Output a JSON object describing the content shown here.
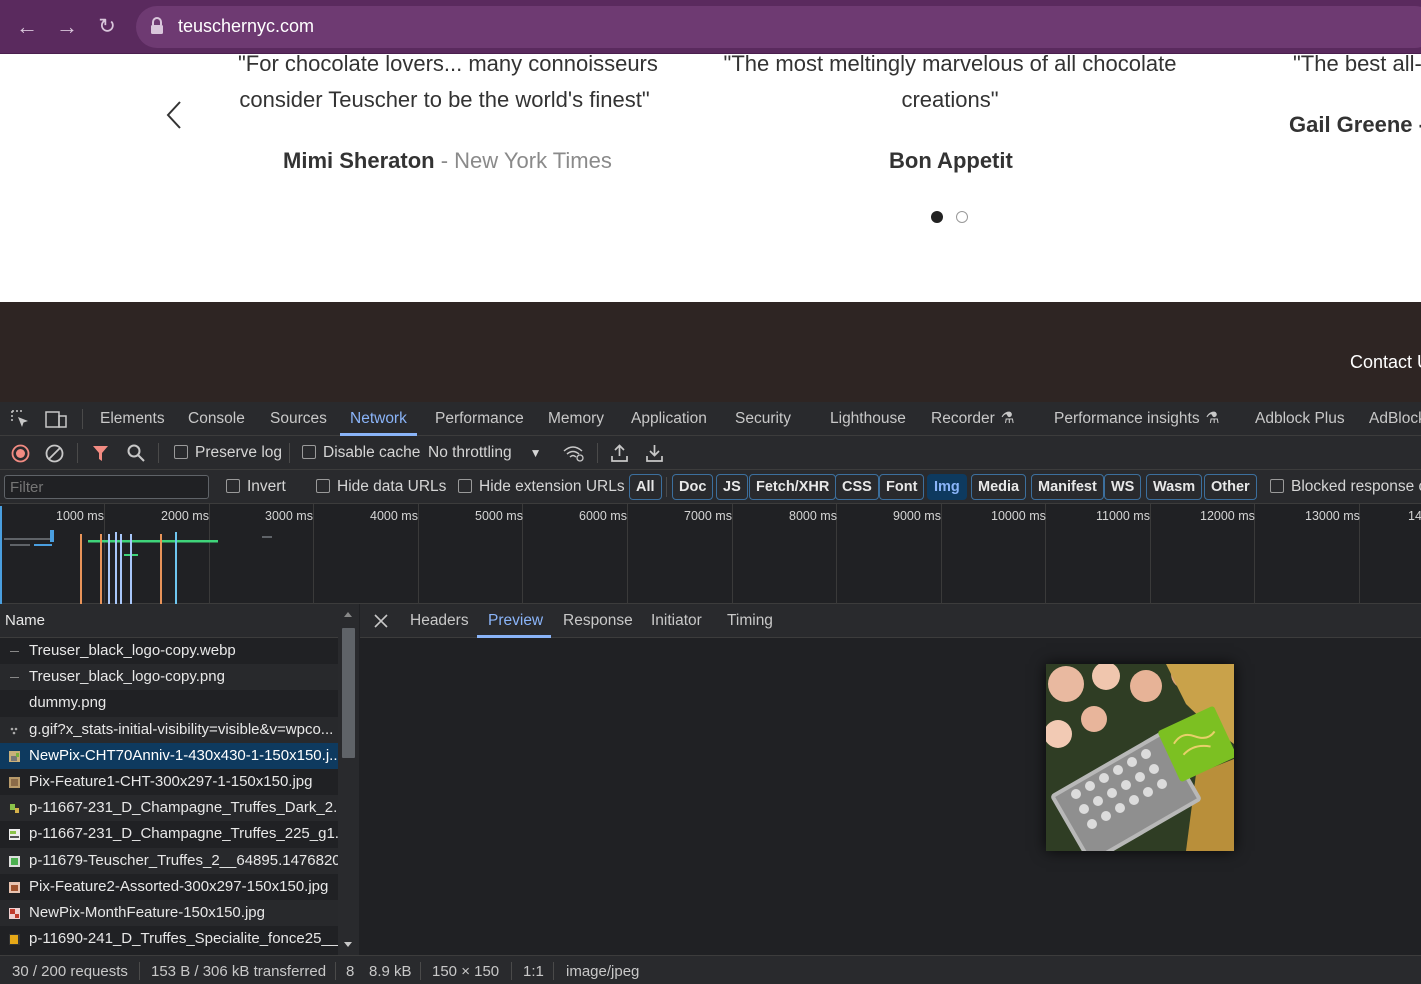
{
  "browser": {
    "url": "teuschernyc.com"
  },
  "testimonials": {
    "items": [
      {
        "quote_line1": "\"For chocolate lovers... many connoisseurs",
        "quote_line2": "consider Teuscher to be the world's finest\"",
        "author": "Mimi Sheraton",
        "source": " - New York Times"
      },
      {
        "quote_line1": "\"The most meltingly marvelous of all chocolate",
        "quote_line2": "creations\"",
        "author": "Bon Appetit",
        "source": ""
      },
      {
        "quote_line1": "\"The best all-",
        "quote_line2": "",
        "author": "Gail Greene -",
        "source": ""
      }
    ],
    "dots": 2,
    "active_dot": 0
  },
  "footer": {
    "contact_label": "Contact U"
  },
  "devtools": {
    "tabs": [
      "Elements",
      "Console",
      "Sources",
      "Network",
      "Performance",
      "Memory",
      "Application",
      "Security",
      "Lighthouse",
      "Recorder",
      "Performance insights",
      "Adblock Plus",
      "AdBlock"
    ],
    "active_tab": "Network",
    "toolbar": {
      "preserve_log": "Preserve log",
      "disable_cache": "Disable cache",
      "throttling": "No throttling"
    },
    "filter": {
      "placeholder": "Filter",
      "invert": "Invert",
      "hide_data_urls": "Hide data URLs",
      "hide_extension_urls": "Hide extension URLs",
      "types": [
        "All",
        "Doc",
        "JS",
        "Fetch/XHR",
        "CSS",
        "Font",
        "Img",
        "Media",
        "Manifest",
        "WS",
        "Wasm",
        "Other"
      ],
      "selected_type": "Img",
      "blocked_response": "Blocked response c"
    },
    "timeline": {
      "ticks": [
        "1000 ms",
        "2000 ms",
        "3000 ms",
        "4000 ms",
        "5000 ms",
        "6000 ms",
        "7000 ms",
        "8000 ms",
        "9000 ms",
        "10000 ms",
        "11000 ms",
        "12000 ms",
        "13000 ms",
        "14"
      ]
    },
    "requests": {
      "header": "Name",
      "rows": [
        {
          "name": "Treuser_black_logo-copy.webp",
          "icon": "dash"
        },
        {
          "name": "Treuser_black_logo-copy.png",
          "icon": "dash"
        },
        {
          "name": "dummy.png",
          "icon": "none"
        },
        {
          "name": "g.gif?x_stats-initial-visibility=visible&v=wpco...",
          "icon": "dots"
        },
        {
          "name": "NewPix-CHT70Anniv-1-430x430-1-150x150.j...",
          "icon": "img",
          "selected": true
        },
        {
          "name": "Pix-Feature1-CHT-300x297-1-150x150.jpg",
          "icon": "img"
        },
        {
          "name": "p-11667-231_D_Champagne_Truffes_Dark_2...",
          "icon": "img"
        },
        {
          "name": "p-11667-231_D_Champagne_Truffes_225_g1...",
          "icon": "img"
        },
        {
          "name": "p-11679-Teuscher_Truffes_2__64895.1476820...",
          "icon": "img"
        },
        {
          "name": "Pix-Feature2-Assorted-300x297-150x150.jpg",
          "icon": "img"
        },
        {
          "name": "NewPix-MonthFeature-150x150.jpg",
          "icon": "img"
        },
        {
          "name": "p-11690-241_D_Truffes_Specialite_fonce25__...",
          "icon": "img"
        }
      ]
    },
    "detail_tabs": [
      "Headers",
      "Preview",
      "Response",
      "Initiator",
      "Timing"
    ],
    "active_detail_tab": "Preview",
    "status": {
      "requests": "30 / 200 requests",
      "transferred": "153 B / 306 kB transferred",
      "truncated": "8",
      "size": "8.9 kB",
      "dimensions": "150 × 150",
      "ratio": "1:1",
      "mime": "image/jpeg"
    }
  }
}
